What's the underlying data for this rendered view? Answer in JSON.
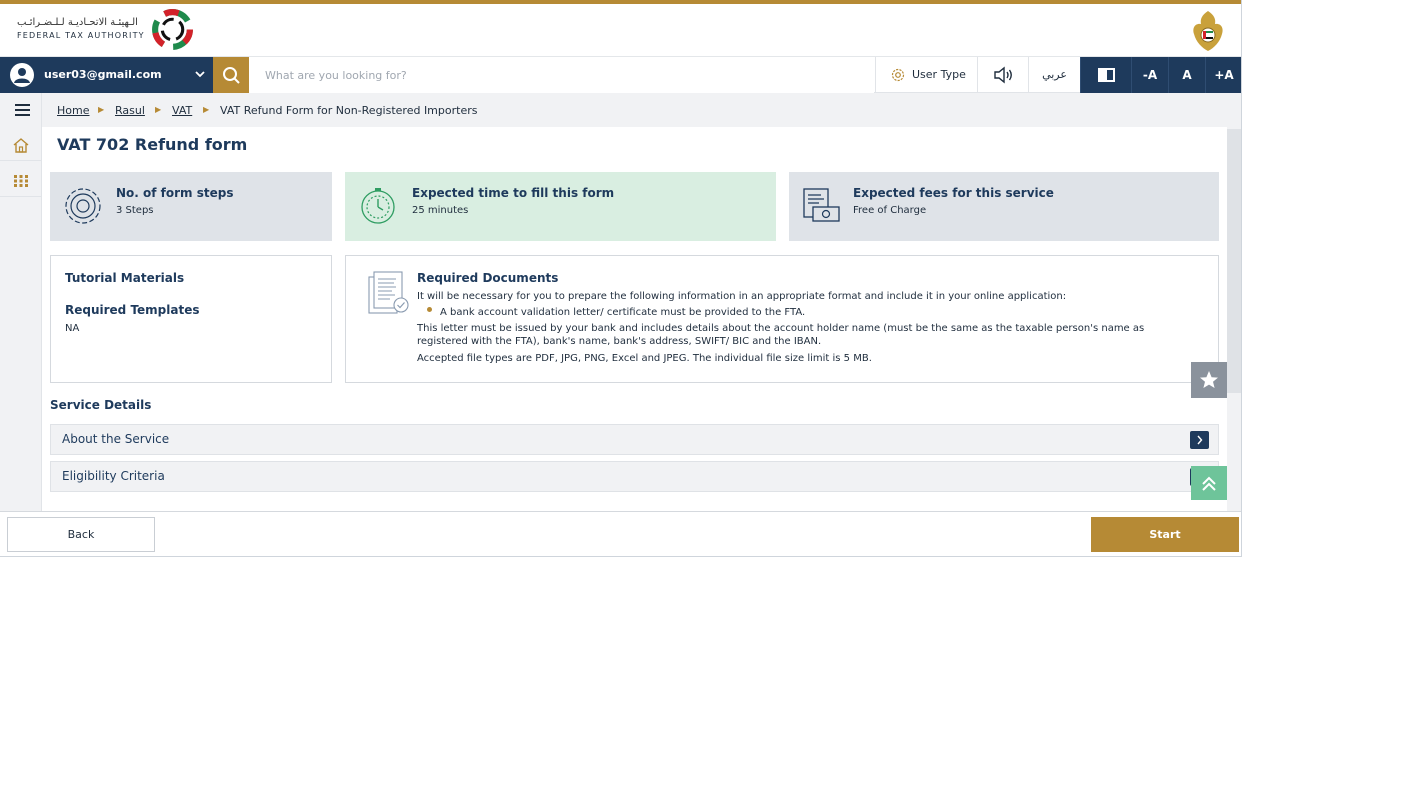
{
  "header": {
    "logo_arabic": "الـهيئـة الاتحـاديـة لـلـضـرائـب",
    "logo_english": "FEDERAL TAX AUTHORITY",
    "emblem_icon": "uae-emblem-icon"
  },
  "topbar": {
    "user_email": "user03@gmail.com",
    "search_placeholder": "What are you looking for?",
    "user_type_label": "User Type",
    "language_label": "عربي",
    "font_decrease": "-A",
    "font_reset": "A",
    "font_increase": "+A"
  },
  "breadcrumb": {
    "items": [
      "Home",
      "Rasul",
      "VAT"
    ],
    "current": "VAT Refund Form for Non-Registered Importers"
  },
  "page": {
    "title": "VAT 702 Refund form"
  },
  "cards": [
    {
      "title": "No. of form steps",
      "value": "3 Steps",
      "icon": "gear-icon"
    },
    {
      "title": "Expected time to fill this form",
      "value": "25 minutes",
      "icon": "stopwatch-icon"
    },
    {
      "title": "Expected fees for this service",
      "value": "Free of Charge",
      "icon": "invoice-cash-icon"
    }
  ],
  "tutorial": {
    "title": "Tutorial Materials",
    "templates_title": "Required Templates",
    "templates_value": "NA"
  },
  "required_docs": {
    "title": "Required Documents",
    "intro": "It will be necessary for you to prepare the following information in an appropriate format and include it in your online application:",
    "bullet": "A bank account validation letter/ certificate must be provided to the FTA.",
    "note_line1": "This letter must be issued by your bank and includes details about the account holder name (must be the same as the taxable person's name as",
    "note_line2": "registered with the FTA), bank's name, bank's address, SWIFT/ BIC and the IBAN.",
    "file_types": "Accepted file types are PDF, JPG, PNG, Excel and JPEG. The individual file size limit is 5 MB."
  },
  "service_details": {
    "title": "Service Details",
    "sections": [
      "About the Service",
      "Eligibility Criteria"
    ]
  },
  "footer": {
    "back_label": "Back",
    "start_label": "Start"
  },
  "colors": {
    "navy": "#1e3a5c",
    "gold": "#b68a35",
    "card_grey": "#dfe3e8",
    "card_green": "#d9eee1"
  }
}
